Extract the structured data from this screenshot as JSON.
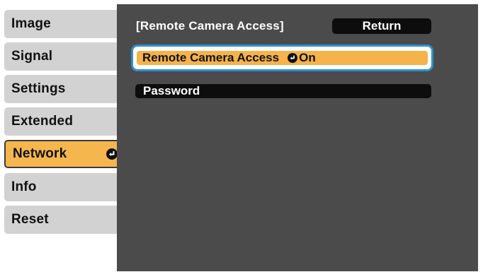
{
  "left_menu": {
    "items": [
      {
        "label": "Image"
      },
      {
        "label": "Signal"
      },
      {
        "label": "Settings"
      },
      {
        "label": "Extended"
      },
      {
        "label": "Network"
      },
      {
        "label": "Info"
      },
      {
        "label": "Reset"
      }
    ],
    "selected_index": 4
  },
  "panel": {
    "title": "[Remote Camera Access]",
    "return_label": "Return",
    "rows": [
      {
        "label": "Remote Camera Access",
        "value": "On"
      },
      {
        "label": "Password"
      }
    ]
  },
  "colors": {
    "menu_bg": "#d2d2d2",
    "selected_accent": "#f6b64e",
    "panel_bg": "#4b4b4b",
    "focus_border": "#2f8fd0"
  },
  "icons": {
    "enter": "enter-icon"
  }
}
